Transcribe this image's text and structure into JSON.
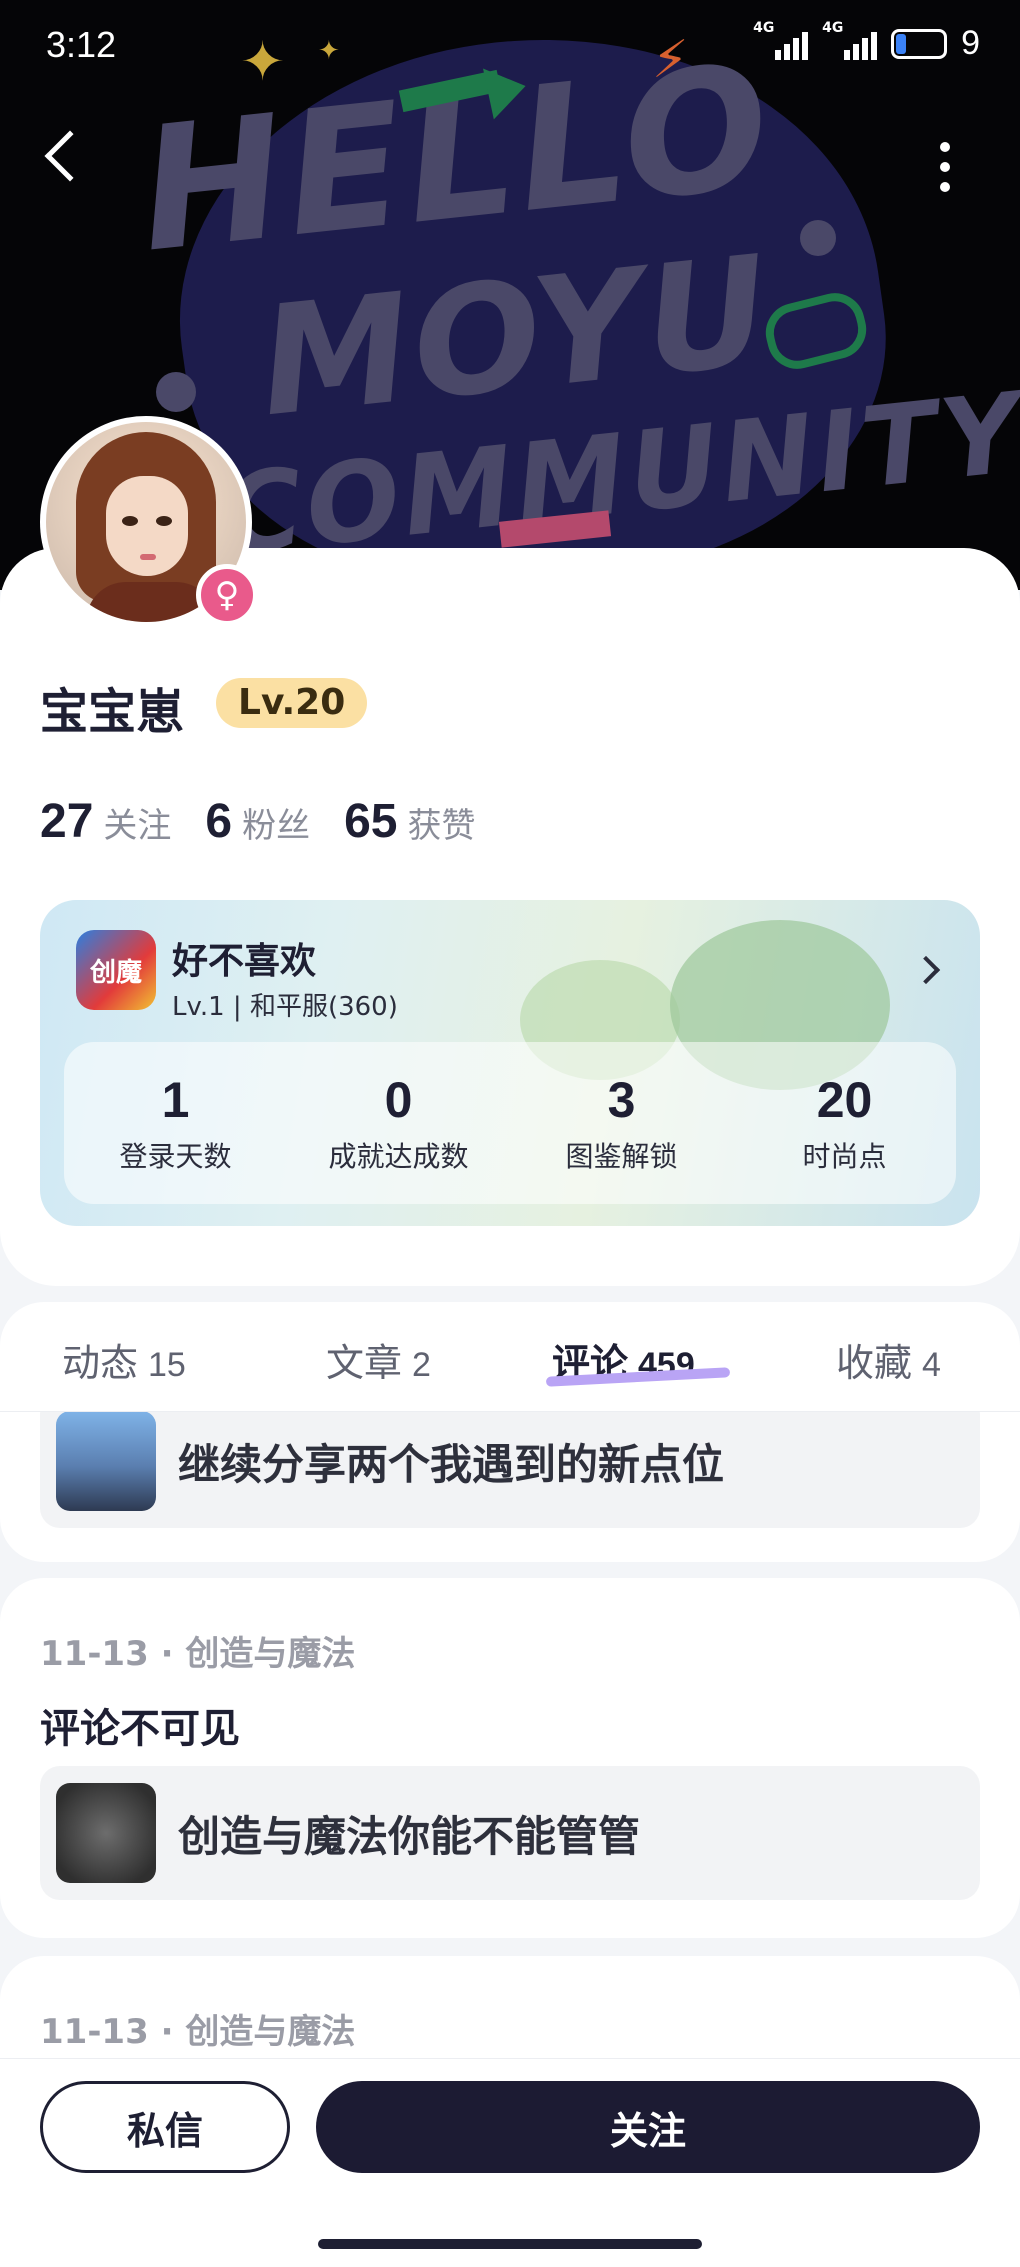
{
  "status_bar": {
    "time": "3:12",
    "network_1": "4G",
    "network_2": "4G",
    "battery": "9"
  },
  "banner": {
    "line1": "HELLO",
    "line2": "MOYU",
    "line3": "COMMUNITY"
  },
  "profile": {
    "username": "宝宝崽",
    "level": "Lv.20",
    "gender_symbol": "♀",
    "stats": [
      {
        "value": "27",
        "label": "关注"
      },
      {
        "value": "6",
        "label": "粉丝"
      },
      {
        "value": "65",
        "label": "获赞"
      }
    ]
  },
  "game_card": {
    "icon_text": "创魔",
    "name": "好不喜欢",
    "sub": "Lv.1 | 和平服(360)",
    "stats": [
      {
        "value": "1",
        "label": "登录天数"
      },
      {
        "value": "0",
        "label": "成就达成数"
      },
      {
        "value": "3",
        "label": "图鉴解锁"
      },
      {
        "value": "20",
        "label": "时尚点"
      }
    ]
  },
  "tabs": [
    {
      "label": "动态",
      "count": "15"
    },
    {
      "label": "文章",
      "count": "2"
    },
    {
      "label": "评论",
      "count": "459"
    },
    {
      "label": "收藏",
      "count": "4"
    }
  ],
  "feed": [
    {
      "meta": "",
      "comment": "",
      "quote": "继续分享两个我遇到的新点位"
    },
    {
      "meta": "11-13 · 创造与魔法",
      "comment": "评论不可见",
      "quote": "创造与魔法你能不能管管"
    },
    {
      "meta": "11-13 · 创造与魔法",
      "comment": "",
      "quote": ""
    }
  ],
  "actions": {
    "message": "私信",
    "follow": "关注"
  },
  "colors": {
    "level_badge": "#fbe0a3",
    "gender_badge": "#e95a8b",
    "follow_button": "#1c1b33",
    "tab_underline": "#b9a4f5"
  }
}
